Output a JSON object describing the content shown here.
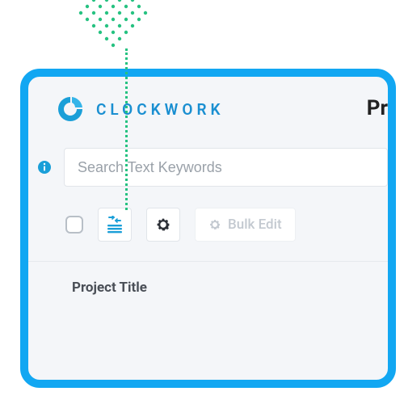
{
  "brand": {
    "name": "CLOCKWORK",
    "accent": "#1a8fd1"
  },
  "page": {
    "title_partial": "Pr"
  },
  "search": {
    "placeholder": "Search Text Keywords",
    "value": ""
  },
  "toolbar": {
    "bulk_edit_label": "Bulk Edit"
  },
  "table": {
    "columns": [
      {
        "label": "Project Title"
      }
    ]
  },
  "icons": {
    "info": "info-icon",
    "columns": "columns-icon",
    "gear": "gear-icon"
  },
  "decor": {
    "dot_color": "#26c281",
    "frame_color": "#12a7f2"
  }
}
